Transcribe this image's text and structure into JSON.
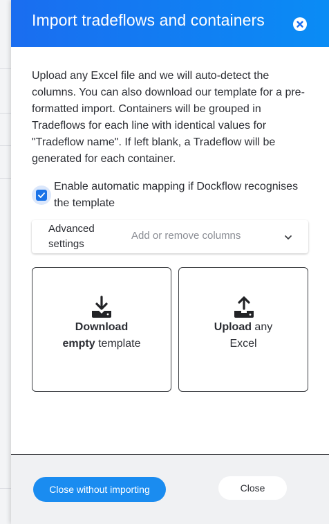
{
  "header": {
    "title": "Import tradeflows and containers",
    "close_icon": "close-circle-icon",
    "gradient_start": "#1a6df0",
    "gradient_end": "#0a8cf5"
  },
  "description": "Upload any Excel file and we will auto-detect the columns. You can also download our template for a pre-formatted import. Containers will be grouped in Tradeflows for each line with identical values for \"Tradeflow name\". If left blank, a Tradeflow will be generated for each container.",
  "auto_mapping": {
    "checked": true,
    "label": "Enable automatic mapping if Dockflow recognises the template",
    "color": "#1a73e8"
  },
  "advanced": {
    "label": "Advanced settings",
    "select_placeholder": "Add or remove columns",
    "chevron_icon": "chevron-down-icon"
  },
  "cards": {
    "download": {
      "icon": "download-icon",
      "bold1": "Download",
      "bold2": "empty",
      "rest": " template"
    },
    "upload": {
      "icon": "upload-icon",
      "bold1": "Upload",
      "rest1": " any",
      "rest2": "Excel"
    }
  },
  "footer": {
    "primary_label": "Close without importing",
    "secondary_label": "Close",
    "primary_color": "#1a8cf0"
  }
}
